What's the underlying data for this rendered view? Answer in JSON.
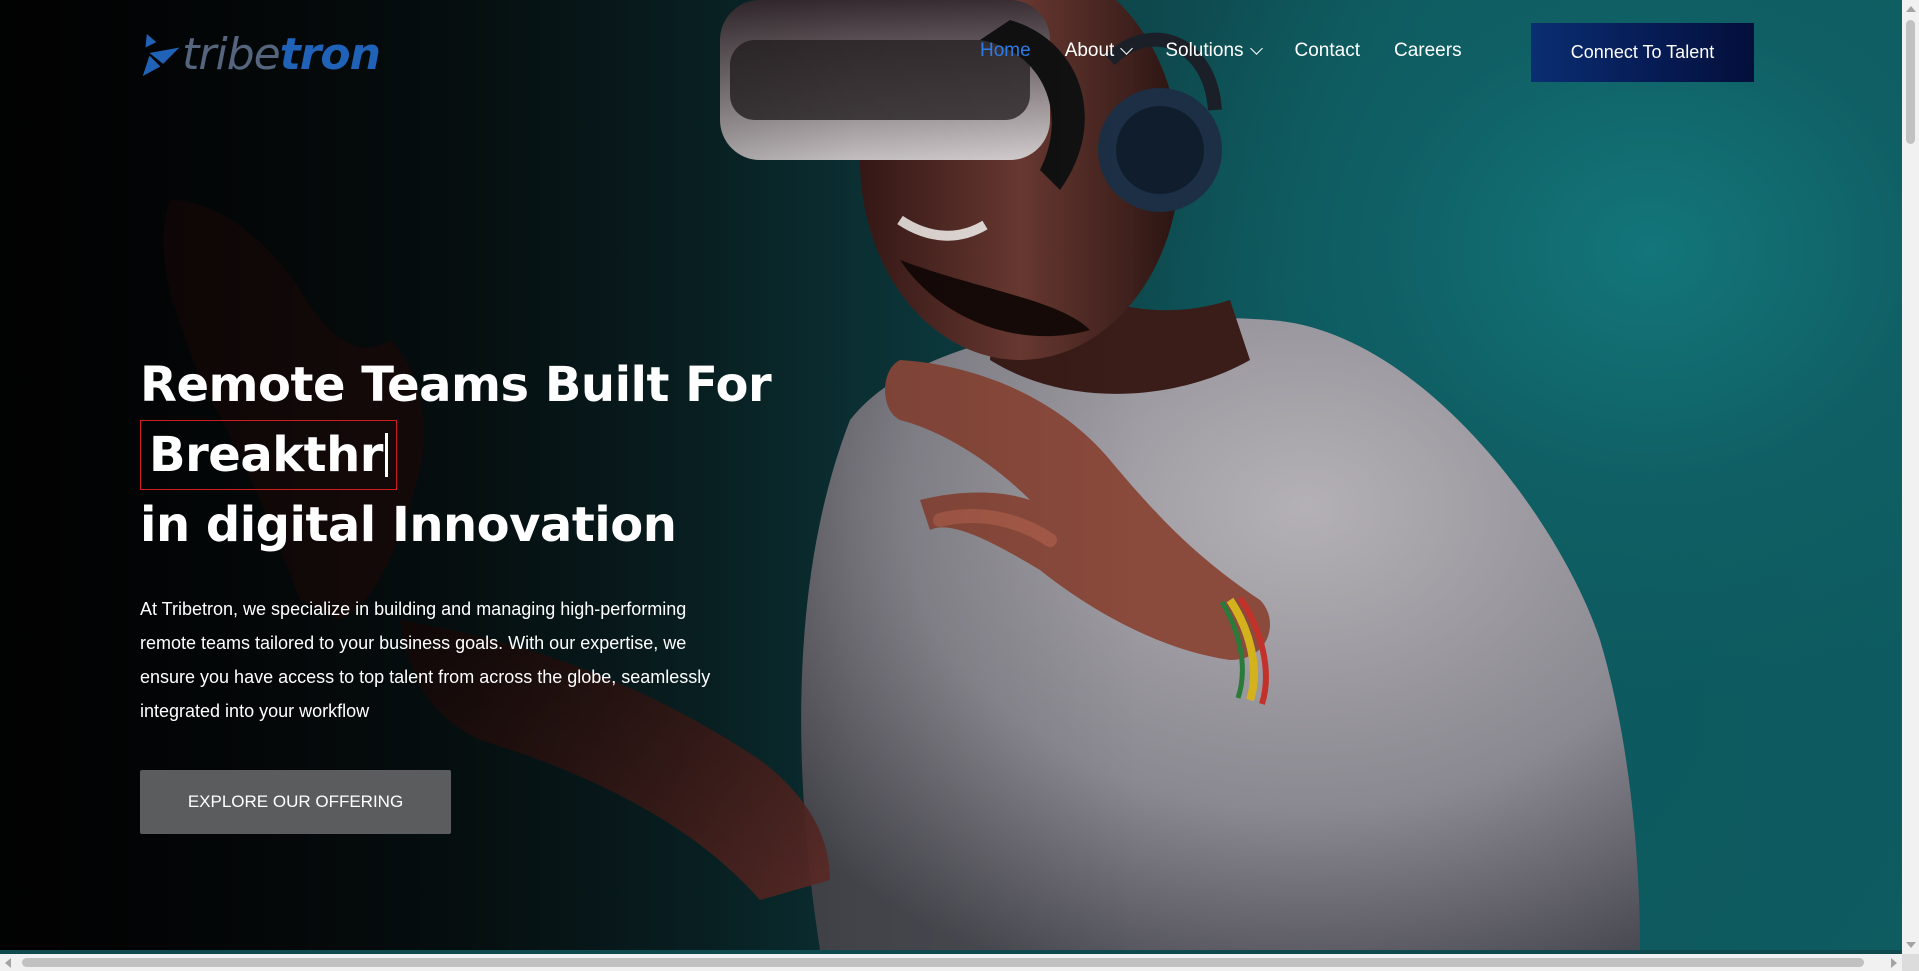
{
  "brand": {
    "logo_light": "tribe",
    "logo_bold": "tron",
    "color_primary": "#1f62b8"
  },
  "nav": {
    "items": [
      {
        "label": "Home",
        "active": true,
        "dropdown": false
      },
      {
        "label": "About",
        "active": false,
        "dropdown": true
      },
      {
        "label": "Solutions",
        "active": false,
        "dropdown": true
      },
      {
        "label": "Contact",
        "active": false,
        "dropdown": false
      },
      {
        "label": "Careers",
        "active": false,
        "dropdown": false
      }
    ],
    "active_color": "#2d7be6"
  },
  "header": {
    "cta_label": "Connect To Talent",
    "cta_color": "#061a52"
  },
  "hero": {
    "title_line1": "Remote Teams Built For",
    "title_typed": "Breakthr",
    "title_line3": "in digital Innovation",
    "description": "At Tribetron, we specialize in building and managing high-performing remote teams tailored to your business goals. With our expertise, we ensure you have access to top talent from across the globe, seamlessly integrated into your workflow",
    "button_label": "EXPLORE OUR OFFERING",
    "typed_box_color": "#d11d1d"
  }
}
